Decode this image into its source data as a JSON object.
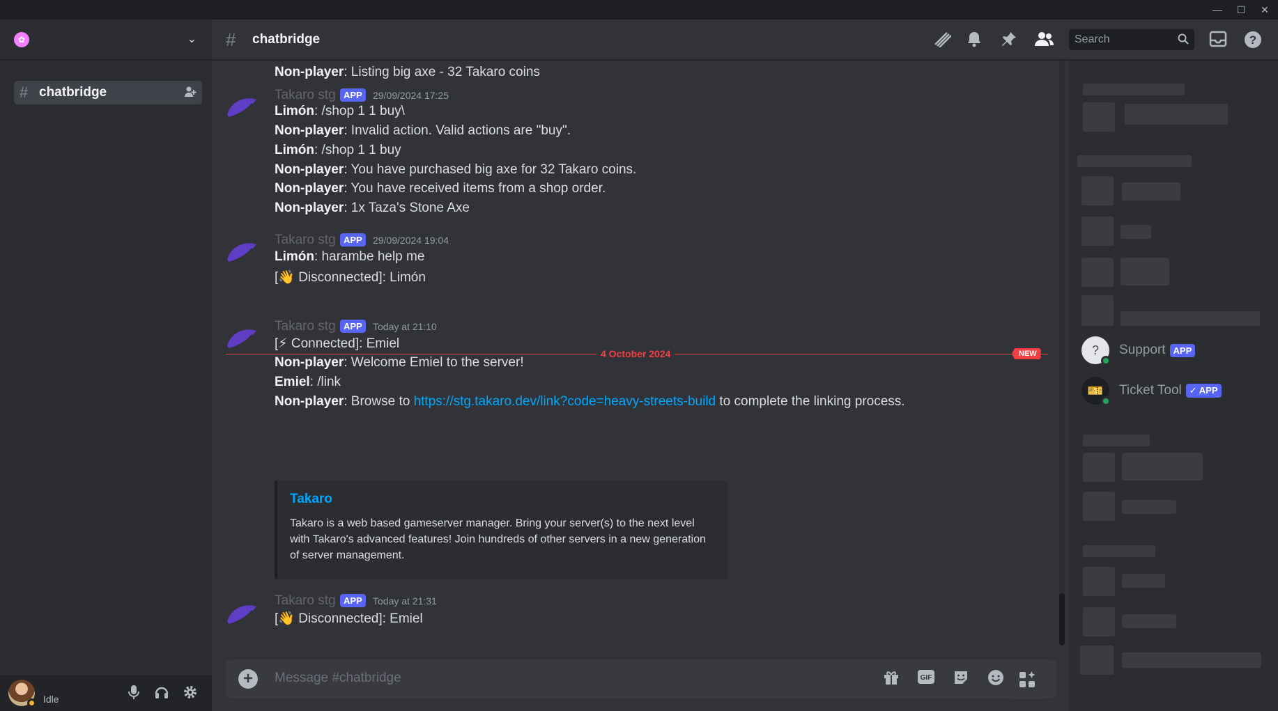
{
  "window": {
    "minimize": "—",
    "maximize": "☐",
    "close": "✕"
  },
  "sidebar": {
    "chevron": "⌄",
    "channel": {
      "hash": "#",
      "name": "chatbridge"
    },
    "user": {
      "status": "Idle"
    }
  },
  "header": {
    "hash": "#",
    "title": "chatbridge",
    "search_placeholder": "Search"
  },
  "messages": {
    "top_line": {
      "speaker": "Non-player",
      "text": ": Listing big axe - 32 Takaro coins"
    },
    "groups": [
      {
        "author": "Takaro stg",
        "badge": "APP",
        "time": "29/09/2024 17:25",
        "lines": [
          {
            "speaker": "Limón",
            "text": ": /shop 1 1 buy\\"
          },
          {
            "speaker": "Non-player",
            "text": ": Invalid action. Valid actions are \"buy\"."
          },
          {
            "speaker": "Limón",
            "text": ": /shop 1 1 buy"
          },
          {
            "speaker": "Non-player",
            "text": ": You have purchased big axe for 32 Takaro coins."
          },
          {
            "speaker": "Non-player",
            "text": ": You have received items from a shop order."
          },
          {
            "speaker": "Non-player",
            "text": ": 1x Taza's Stone Axe"
          }
        ]
      },
      {
        "author": "Takaro stg",
        "badge": "APP",
        "time": "29/09/2024 19:04",
        "lines": [
          {
            "speaker": "Limón",
            "text": ": harambe help me"
          },
          {
            "speaker": "",
            "text": "[👋 Disconnected]: Limón"
          }
        ]
      },
      {
        "author": "Takaro stg",
        "badge": "APP",
        "time": "Today at 21:10",
        "lines": [
          {
            "speaker": "",
            "text": "[⚡ Connected]: Emiel"
          },
          {
            "speaker": "Non-player",
            "text": ": Welcome Emiel to the server!"
          },
          {
            "speaker": "Emiel",
            "text": ": /link"
          },
          {
            "speaker": "Non-player",
            "text": ": Browse to ",
            "link": "https://stg.takaro.dev/link?code=heavy-streets-build",
            "after": " to complete the linking process."
          }
        ]
      },
      {
        "author": "Takaro stg",
        "badge": "APP",
        "time": "Today at 21:31",
        "lines": [
          {
            "speaker": "",
            "text": "[👋 Disconnected]: Emiel"
          }
        ]
      }
    ],
    "divider": {
      "date": "4 October 2024",
      "badge": "NEW"
    },
    "embed": {
      "title": "Takaro",
      "description": "Takaro is a web based gameserver manager. Bring your server(s) to the next level with Takaro's advanced features! Join hundreds of other servers in a new generation of server management."
    }
  },
  "composer": {
    "plus": "+",
    "placeholder": "Message #chatbridge",
    "gif": "GIF"
  },
  "members": {
    "items": [
      {
        "name": "Support",
        "badge": "APP"
      },
      {
        "name": "Ticket Tool",
        "badge": "✓ APP"
      }
    ]
  }
}
